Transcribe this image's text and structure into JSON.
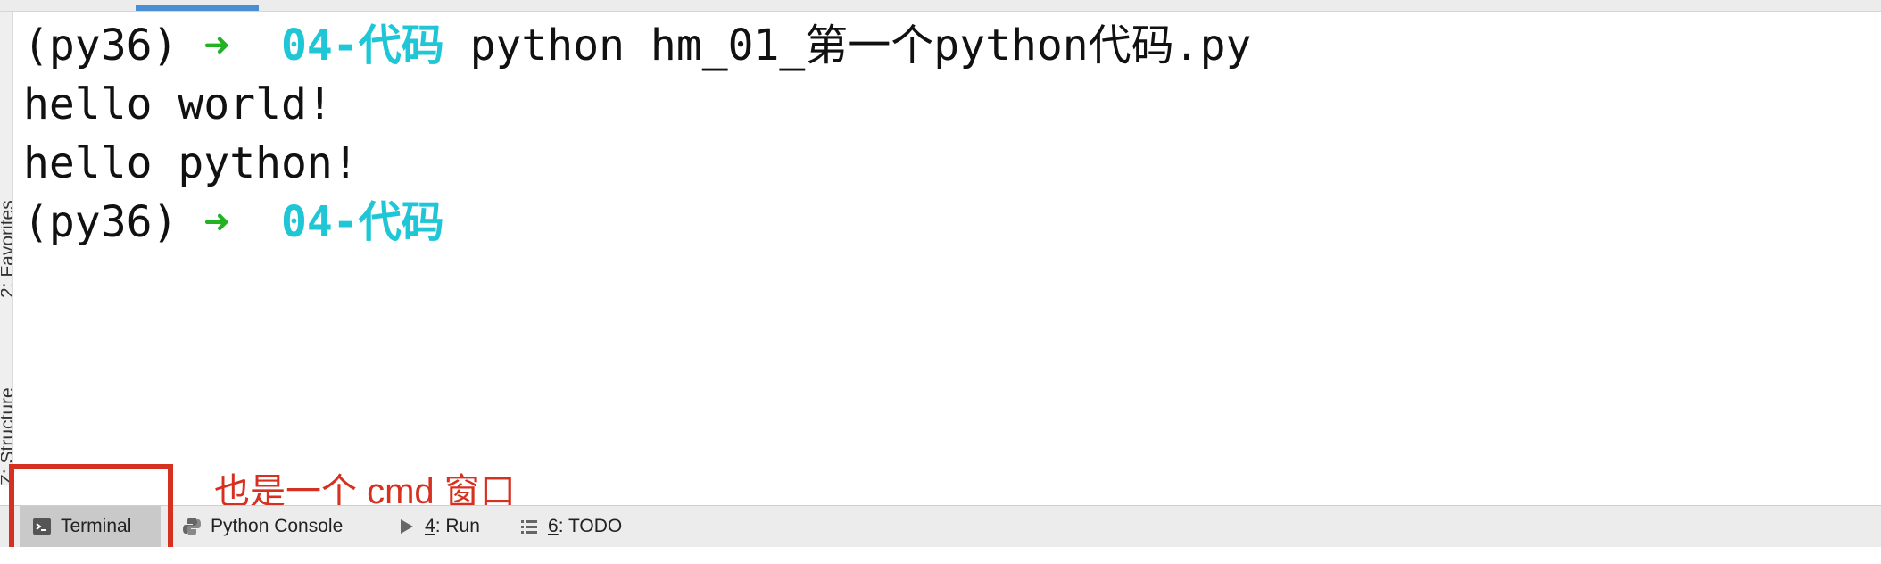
{
  "terminal": {
    "lines": [
      {
        "env": "(py36)",
        "arrow": "➜",
        "dir": "04-代码",
        "command": "python hm_01_第一个python代码.py"
      },
      {
        "output": "hello world!"
      },
      {
        "output": "hello python!"
      },
      {
        "env": "(py36)",
        "arrow": "➜",
        "dir": "04-代码",
        "command": ""
      }
    ]
  },
  "annotation": {
    "text": "也是一个 cmd 窗口"
  },
  "left_stripe": {
    "favorites": "2: Favorites",
    "structure": "Z: Structure"
  },
  "bottom_bar": {
    "tabs": [
      {
        "label": "Terminal",
        "icon": "terminal-icon",
        "active": true
      },
      {
        "label": "Python Console",
        "icon": "python-icon",
        "active": false
      },
      {
        "mnemonic": "4",
        "rest": ": Run",
        "icon": "run-icon",
        "active": false
      },
      {
        "mnemonic": "6",
        "rest": ": TODO",
        "icon": "todo-list-icon",
        "active": false
      }
    ]
  },
  "colors": {
    "prompt_arrow": "#22b322",
    "prompt_dir": "#1ec6d6",
    "annotation": "#d63020",
    "active_tab_bg": "#c9c9c9"
  }
}
